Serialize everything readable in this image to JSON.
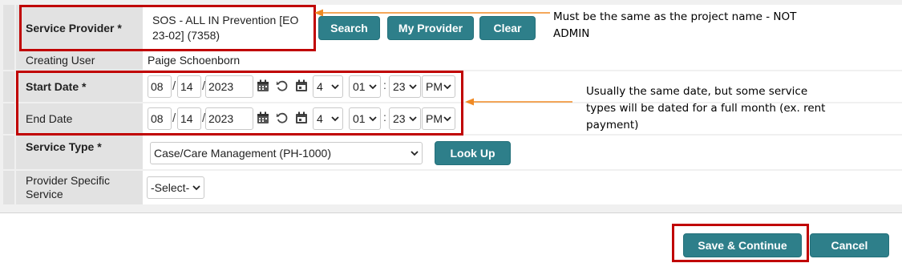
{
  "service_provider": {
    "label": "Service Provider *",
    "value": "SOS - ALL IN Prevention [EO 23-02] (7358)",
    "search_label": "Search",
    "my_provider_label": "My Provider",
    "clear_label": "Clear"
  },
  "creating_user": {
    "label": "Creating User",
    "value": "Paige Schoenborn"
  },
  "start_date": {
    "label": "Start Date *",
    "month": "08",
    "day": "14",
    "year": "2023",
    "hour": "4",
    "minute": "01",
    "second": "23",
    "ampm": "PM"
  },
  "end_date": {
    "label": "End Date",
    "month": "08",
    "day": "14",
    "year": "2023",
    "hour": "4",
    "minute": "01",
    "second": "23",
    "ampm": "PM"
  },
  "service_type": {
    "label": "Service Type *",
    "value": "Case/Care Management (PH-1000)",
    "lookup_label": "Look Up"
  },
  "provider_specific_service": {
    "label": "Provider Specific Service",
    "value": "-Select-"
  },
  "footer": {
    "save_label": "Save & Continue",
    "cancel_label": "Cancel"
  },
  "annotations": {
    "provider_note": "Must be the same as the project name - NOT ADMIN",
    "date_note": "Usually the same date, but some service types will be dated for a full month (ex. rent payment)"
  },
  "colors": {
    "button": "#2e7f8a",
    "highlight": "#c00000",
    "arrow": "#f08a24"
  }
}
